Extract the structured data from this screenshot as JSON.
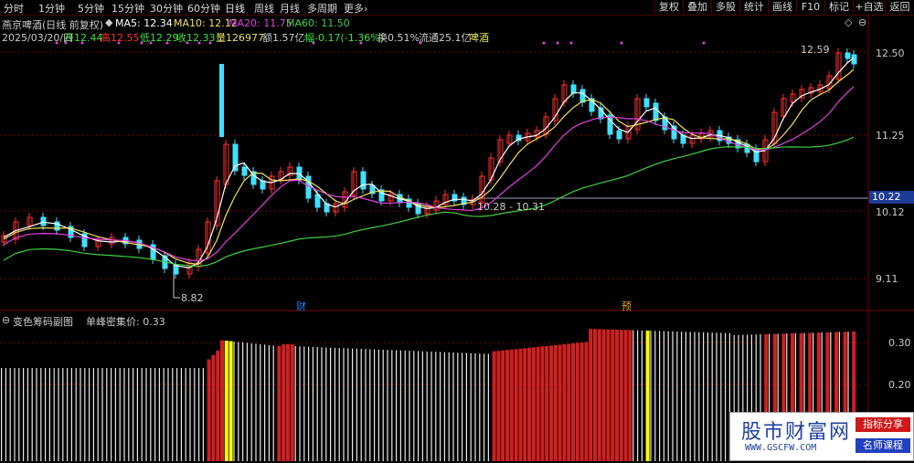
{
  "toolbar": {
    "tabs": [
      "分时",
      "1分钟",
      "5分钟",
      "15分钟",
      "30分钟",
      "60分钟",
      "日线",
      "周线",
      "月线",
      "多周期",
      "更多›"
    ],
    "active_tab": "日线",
    "right_buttons": [
      "复权",
      "叠加",
      "多股",
      "统计",
      "画线",
      "F10",
      "标记",
      "+自选",
      "返回"
    ]
  },
  "header": {
    "stock_title": "燕京啤酒(日线 前复权)",
    "ma5": "MA5: 12.34",
    "ma10": "MA10: 12.12",
    "ma20": "MA20: 11.75",
    "ma60": "MA60: 11.50",
    "date": "2025/03/20/四",
    "open": "开12.44",
    "high": "高12.55",
    "low": "低12.29",
    "close": "收12.33",
    "volume": "量126977",
    "amount": "额1.57亿",
    "change": "幅-0.17(-1.36%)",
    "turnover": "换0.51%",
    "float": "流通25.1亿",
    "sector": "啤酒"
  },
  "price_axis": [
    "12.50",
    "11.25",
    "10.12",
    "9.11"
  ],
  "current_price_tag": "10.22",
  "annotations": {
    "low_marker": "8.82",
    "high_marker": "12.59",
    "range_label": "10.28 - 10.31",
    "event_cai": "财",
    "event_yu": "预"
  },
  "indicator": {
    "title": "变色筹码副图",
    "value_label": "单峰密集价: 0.33",
    "axis": [
      "0.30",
      "0.20"
    ]
  },
  "colors": {
    "up": "#ff3030",
    "down": "#40e0ff",
    "ma5": "#ffffff",
    "ma10": "#f0e060",
    "ma20": "#e040e0",
    "ma60": "#40d040",
    "grid": "#7a0000"
  },
  "watermark": {
    "site": "股市财富网",
    "url": "WWW.GSCFW.COM",
    "badge1": "指标分享",
    "badge2": "名师课程"
  }
}
